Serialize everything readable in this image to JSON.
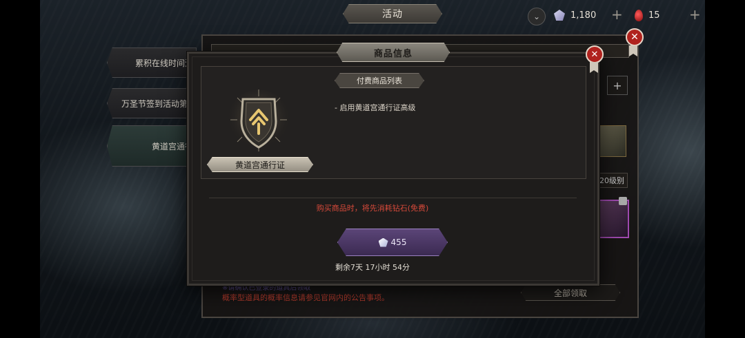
{
  "top_bar": {
    "tab_label": "活动",
    "diamonds": "1,180",
    "blood": "15",
    "plus": "+",
    "expand_icon": "chevron-down-icon",
    "diamond_icon": "diamond-icon",
    "blood_icon": "blood-drop-icon"
  },
  "left_menu": {
    "items": [
      {
        "label": "累积在线时间活"
      },
      {
        "label": "万圣节签到活动第一"
      },
      {
        "label": "黄道宫通行"
      }
    ]
  },
  "background_panel": {
    "level_badge": "20级别",
    "claim_all": "全部领取",
    "notice_line1": "※请确认已登录的道具后领取",
    "notice_line2": "概率型道具的概率信息请参见官网内的公告事项。",
    "plus": "+"
  },
  "modal": {
    "title": "商品信息",
    "list_header": "付费商品列表",
    "list_item": "- 启用黄道宫通行证高级",
    "product_name": "黄道宫通行证",
    "warning": "购买商品时，将先消耗钻石(免费)",
    "price": "455",
    "remaining": "剩余7天 17小时 54分",
    "close_icon": "close-icon"
  },
  "colors": {
    "warning": "#d6493a",
    "close_button": "#b0221e",
    "buy_button": "#5b4578"
  }
}
